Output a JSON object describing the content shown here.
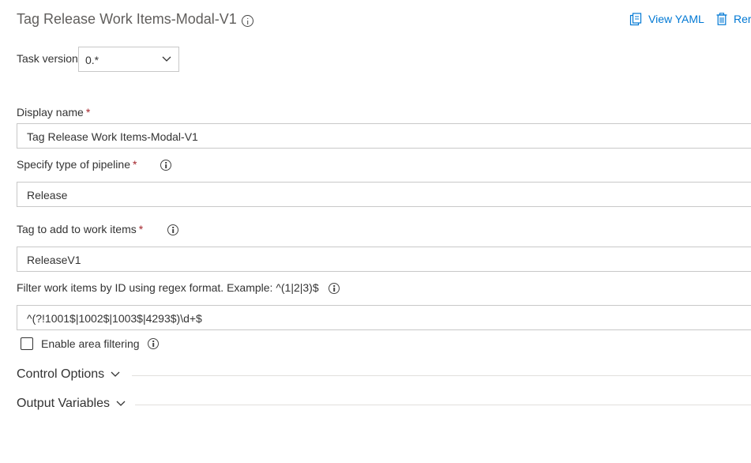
{
  "header": {
    "title": "Tag Release Work Items-Modal-V1",
    "view_yaml_label": "View YAML",
    "remove_label": "Rer"
  },
  "task_version": {
    "label": "Task version",
    "value": "0.*"
  },
  "fields": {
    "display_name": {
      "label": "Display name",
      "required_mark": "*",
      "value": "Tag Release Work Items-Modal-V1"
    },
    "pipeline_type": {
      "label": "Specify type of pipeline",
      "required_mark": "*",
      "value": "Release"
    },
    "tag": {
      "label": "Tag to add to work items",
      "required_mark": "*",
      "value": "ReleaseV1"
    },
    "filter": {
      "label": "Filter work items by ID using regex format. Example: ^(1|2|3)$",
      "value": "^(?!1001$|1002$|1003$|4293$)\\d+$"
    }
  },
  "area_filtering": {
    "label": "Enable area filtering",
    "checked": false
  },
  "sections": {
    "control_options": "Control Options",
    "output_variables": "Output Variables"
  },
  "colors": {
    "accent": "#0078d4",
    "required": "#a4262c",
    "border": "#c8c8c8"
  }
}
